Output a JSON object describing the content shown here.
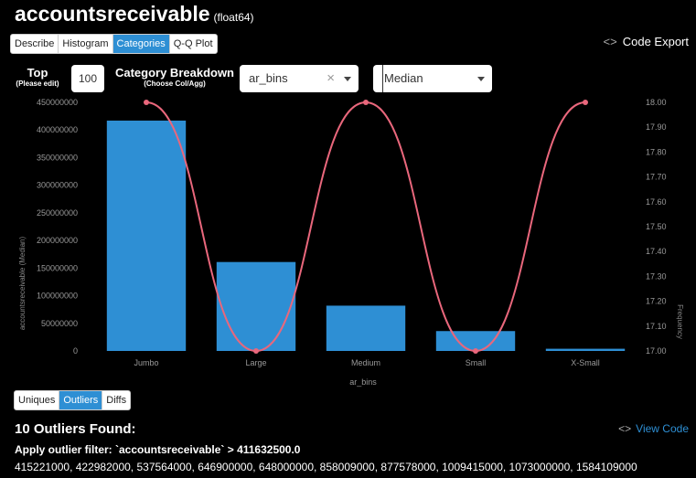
{
  "header": {
    "column_name": "accountsreceivable",
    "dtype": "(float64)"
  },
  "tabs": [
    {
      "label": "Describe",
      "active": false
    },
    {
      "label": "Histogram",
      "active": false
    },
    {
      "label": "Categories",
      "active": true
    },
    {
      "label": "Q-Q Plot",
      "active": false
    }
  ],
  "code_export": {
    "icon": "code-icon",
    "label": "Code Export"
  },
  "controls": {
    "top_label": "Top",
    "top_sublabel": "(Please edit)",
    "top_value": "100",
    "category_label": "Category Breakdown",
    "category_sublabel": "(Choose Col/Agg)",
    "column_select": "ar_bins",
    "agg_select": "Median"
  },
  "chart_data": {
    "type": "bar",
    "categories": [
      "Jumbo",
      "Large",
      "Medium",
      "Small",
      "X-Small"
    ],
    "series": [
      {
        "values": [
          417000000,
          161000000,
          82000000,
          36000000,
          4000000
        ],
        "axis": "left",
        "color": "#2e8fd4"
      },
      {
        "values": [
          18,
          17,
          18,
          17,
          18
        ],
        "axis": "right",
        "type": "line",
        "color": "#e9677c"
      }
    ],
    "xlabel": "ar_bins",
    "ylabel": "accountsreceivable (Median)",
    "y2label": "Frequency",
    "ylim": [
      0,
      450000000
    ],
    "y2lim": [
      17,
      18
    ],
    "yticks": [
      "0",
      "50000000",
      "100000000",
      "150000000",
      "200000000",
      "250000000",
      "300000000",
      "350000000",
      "400000000",
      "450000000"
    ],
    "y2ticks": [
      "17.00",
      "17.10",
      "17.20",
      "17.30",
      "17.40",
      "17.50",
      "17.60",
      "17.70",
      "17.80",
      "17.90",
      "18.00"
    ],
    "grid": false
  },
  "bottom_tabs": [
    {
      "label": "Uniques",
      "active": false
    },
    {
      "label": "Outliers",
      "active": true
    },
    {
      "label": "Diffs",
      "active": false
    }
  ],
  "outliers": {
    "title": "10 Outliers Found:",
    "view_code": "View Code",
    "filter_text": "Apply outlier filter: `accountsreceivable` > 411632500.0",
    "values": "415221000, 422982000, 537564000, 646900000, 648000000, 858009000, 877578000, 1009415000, 1073000000, 1584109000"
  }
}
